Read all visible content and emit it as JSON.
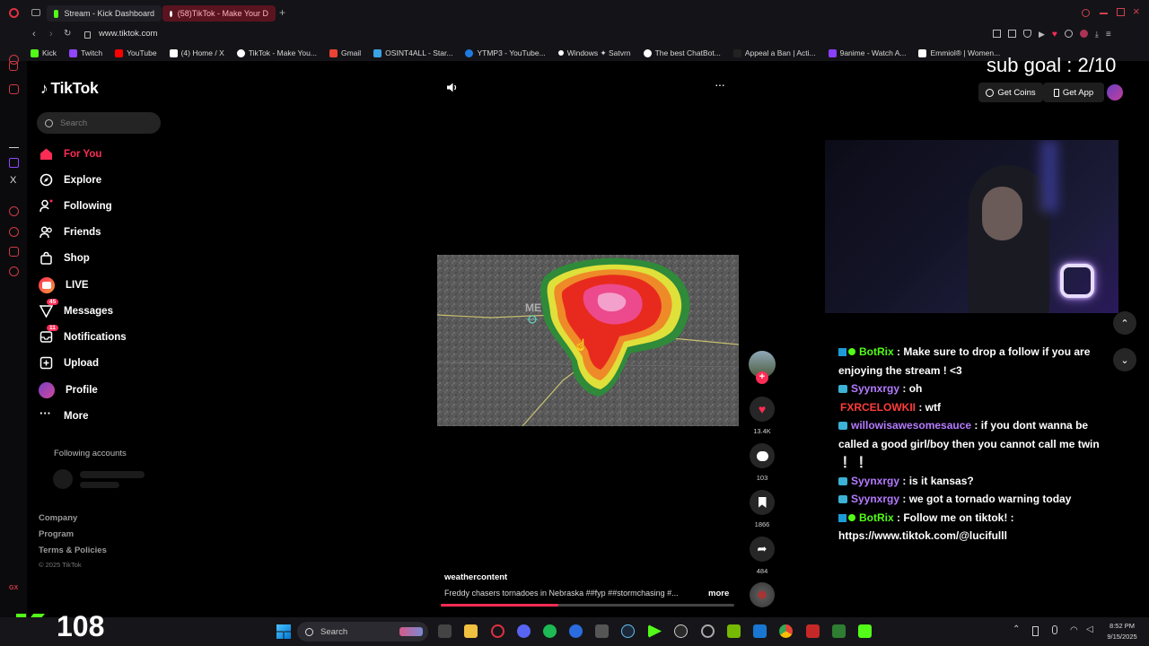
{
  "browser": {
    "tabs": [
      {
        "label": "Stream - Kick Dashboard",
        "favicon_color": "#53fc18"
      },
      {
        "label": "(58)TikTok - Make Your D",
        "favicon_color": "#ffffff"
      }
    ],
    "url": "www.tiktok.com",
    "bookmarks": [
      {
        "label": "Kick",
        "color": "#53fc18"
      },
      {
        "label": "Twitch",
        "color": "#9146ff"
      },
      {
        "label": "YouTube",
        "color": "#ff0000"
      },
      {
        "label": "(4) Home / X",
        "color": "#ffffff"
      },
      {
        "label": "TikTok - Make You...",
        "color": "#ffffff"
      },
      {
        "label": "Gmail",
        "color": "#ea4335"
      },
      {
        "label": "OSINT4ALL - Star...",
        "color": "#3aa3e3"
      },
      {
        "label": "YTMP3 - YouTube...",
        "color": "#1f7ae0"
      },
      {
        "label": "Windows ✦ Satvrn",
        "color": "#ffffff"
      },
      {
        "label": "The best ChatBot...",
        "color": "#ffffff"
      },
      {
        "label": "Appeal a Ban | Acti...",
        "color": "#222222"
      },
      {
        "label": "9anime - Watch A...",
        "color": "#8a3ffc"
      },
      {
        "label": "Emmiol® | Women...",
        "color": "#ffffff"
      }
    ]
  },
  "tiktok": {
    "logo": "TikTok",
    "search_placeholder": "Search",
    "nav": [
      {
        "label": "For You",
        "icon": "home-icon",
        "active": true
      },
      {
        "label": "Explore",
        "icon": "compass-icon"
      },
      {
        "label": "Following",
        "icon": "following-icon"
      },
      {
        "label": "Friends",
        "icon": "friends-icon"
      },
      {
        "label": "Shop",
        "icon": "shop-icon"
      },
      {
        "label": "LIVE",
        "icon": "live-icon"
      },
      {
        "label": "Messages",
        "icon": "messages-icon",
        "badge": "45"
      },
      {
        "label": "Notifications",
        "icon": "inbox-icon",
        "badge": "11"
      },
      {
        "label": "Upload",
        "icon": "upload-icon"
      },
      {
        "label": "Profile",
        "icon": "avatar-icon"
      },
      {
        "label": "More",
        "icon": "more-icon"
      }
    ],
    "following_accounts": "Following accounts",
    "footer": [
      "Company",
      "Program",
      "Terms & Policies"
    ],
    "copyright": "© 2025 TikTok",
    "header": {
      "get_coins": "Get Coins",
      "get_app": "Get App"
    },
    "video": {
      "author": "weathercontent",
      "caption": "Freddy chasers tornadoes in Nebraska ##fyp ##stormchasing #...",
      "more": "more",
      "progress": 0.4,
      "map_label": "ME"
    },
    "actions": {
      "likes": "13.4K",
      "comments": "103",
      "saves": "1866",
      "shares": "484"
    }
  },
  "stream": {
    "sub_goal": "sub goal : 2/10",
    "counter": "108",
    "chat": [
      {
        "user": "BotRix",
        "text": "Make sure to drop a follow if you are enjoying the stream ! <3",
        "color": "#53fc18"
      },
      {
        "user": "Syynxrgy",
        "text": "oh",
        "color": "#b57bff"
      },
      {
        "user": "FXRCELOWKII",
        "text": "wtf",
        "color": "#ff3b3b"
      },
      {
        "user": "willowisawesomesauce",
        "text": "if you dont wanna be called a good girl/boy then you cannot call me twin ❕ ❕",
        "color": "#b57bff"
      },
      {
        "user": "Syynxrgy",
        "text": "is it kansas?",
        "color": "#b57bff"
      },
      {
        "user": "Syynxrgy",
        "text": "we got a tornado warning today",
        "color": "#b57bff"
      },
      {
        "user": "BotRix",
        "text": "Follow me on tiktok! : https://www.tiktok.com/@lucifulll",
        "color": "#53fc18"
      }
    ]
  },
  "taskbar": {
    "search": "Search",
    "time": "8:52 PM",
    "date": "9/15/2025"
  }
}
